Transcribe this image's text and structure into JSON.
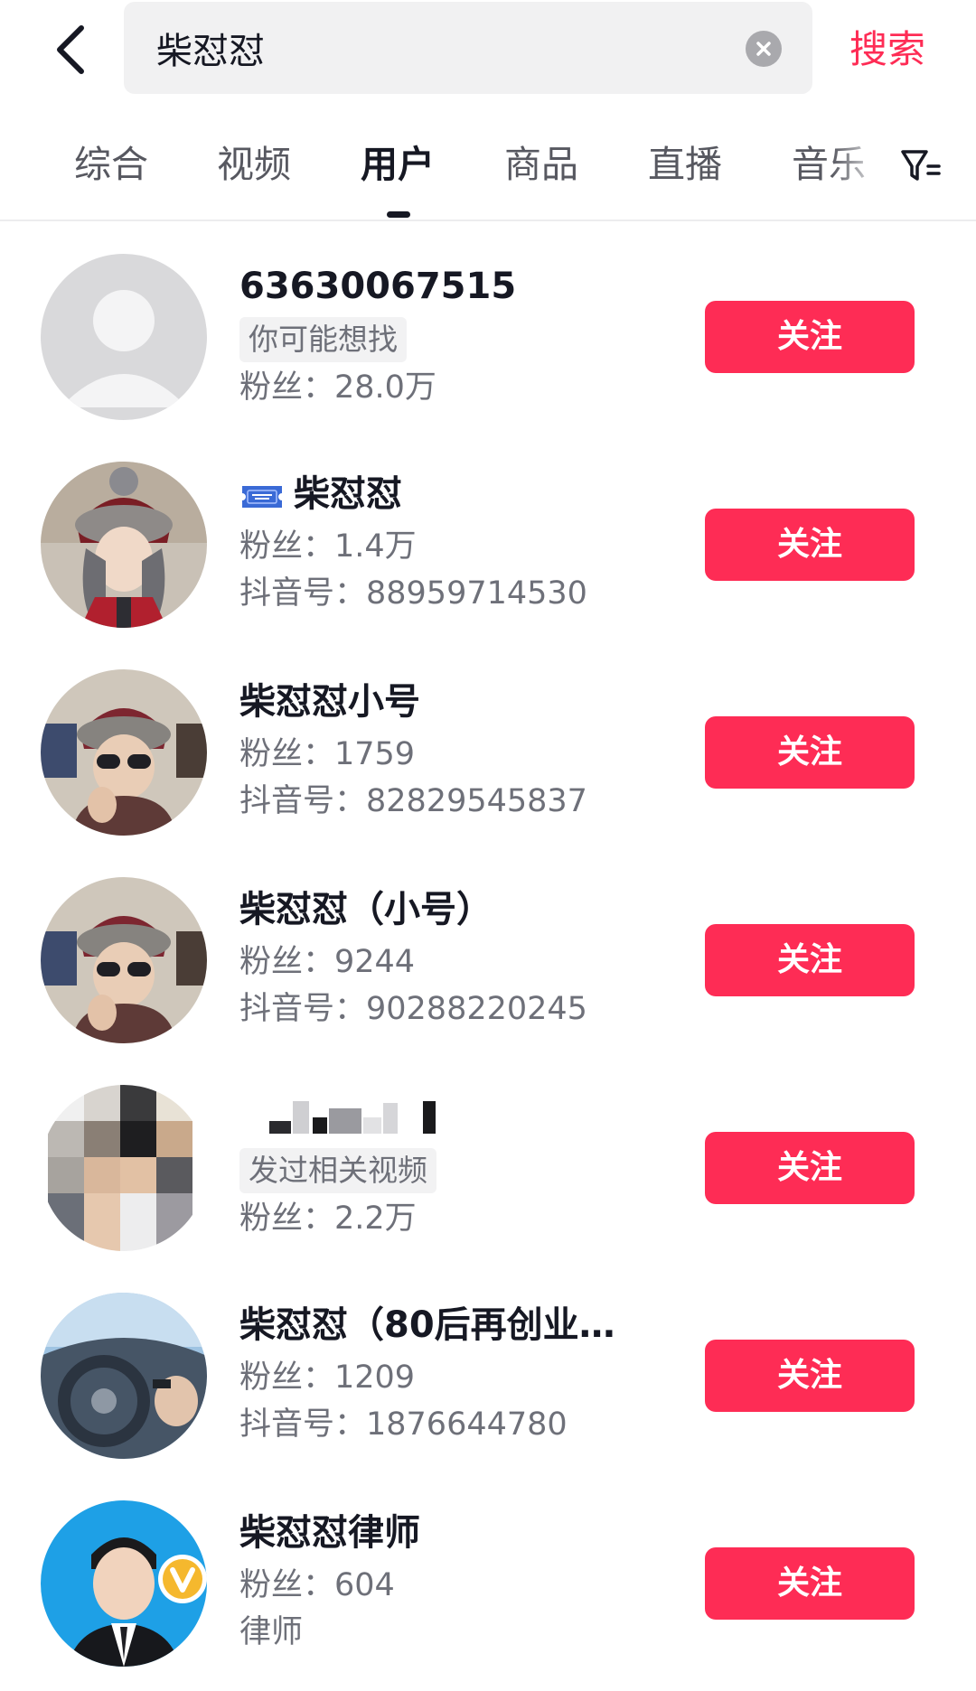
{
  "search": {
    "query": "柴怼怼",
    "submit_label": "搜索"
  },
  "tabs": [
    {
      "label": "综合",
      "active": false
    },
    {
      "label": "视频",
      "active": false
    },
    {
      "label": "用户",
      "active": true
    },
    {
      "label": "商品",
      "active": false
    },
    {
      "label": "直播",
      "active": false
    },
    {
      "label": "音乐",
      "active": false
    }
  ],
  "users": [
    {
      "name": "63630067515",
      "tag": "你可能想找",
      "fans": "粉丝：28.0万",
      "follow_label": "关注",
      "avatar": "default-avatar"
    },
    {
      "name": "柴怼怼",
      "fans": "粉丝：1.4万",
      "douyin_id": "抖音号：88959714530",
      "follow_label": "关注",
      "avatar": "photo-avatar",
      "badge": "admit-one-ticket-icon"
    },
    {
      "name": "柴怼怼小号",
      "fans": "粉丝：1759",
      "douyin_id": "抖音号：82829545837",
      "follow_label": "关注",
      "avatar": "photo-avatar"
    },
    {
      "name": "柴怼怼（小号）",
      "fans": "粉丝：9244",
      "douyin_id": "抖音号：90288220245",
      "follow_label": "关注",
      "avatar": "photo-avatar"
    },
    {
      "name": "",
      "tag": "发过相关视频",
      "fans": "粉丝：2.2万",
      "follow_label": "关注",
      "avatar": "blurred-avatar"
    },
    {
      "name": "柴怼怼（80后再创业…",
      "fans": "粉丝：1209",
      "douyin_id": "抖音号：1876644780",
      "follow_label": "关注",
      "avatar": "photo-avatar"
    },
    {
      "name": "柴怼怼律师",
      "fans": "粉丝：604",
      "profession": "律师",
      "follow_label": "关注",
      "avatar": "photo-avatar",
      "verified": "gold-v-verified-icon"
    }
  ],
  "colors": {
    "accent": "#fe2c55",
    "text_primary": "#161823",
    "text_secondary": "#6e7079",
    "search_bg": "#f1f1f2",
    "tag_bg": "#f2f2f3",
    "verified_gold": "#f5b82e"
  },
  "icons": [
    "back-arrow-icon",
    "clear-icon",
    "filter-icon",
    "admit-one-ticket-icon",
    "gold-v-verified-icon"
  ]
}
